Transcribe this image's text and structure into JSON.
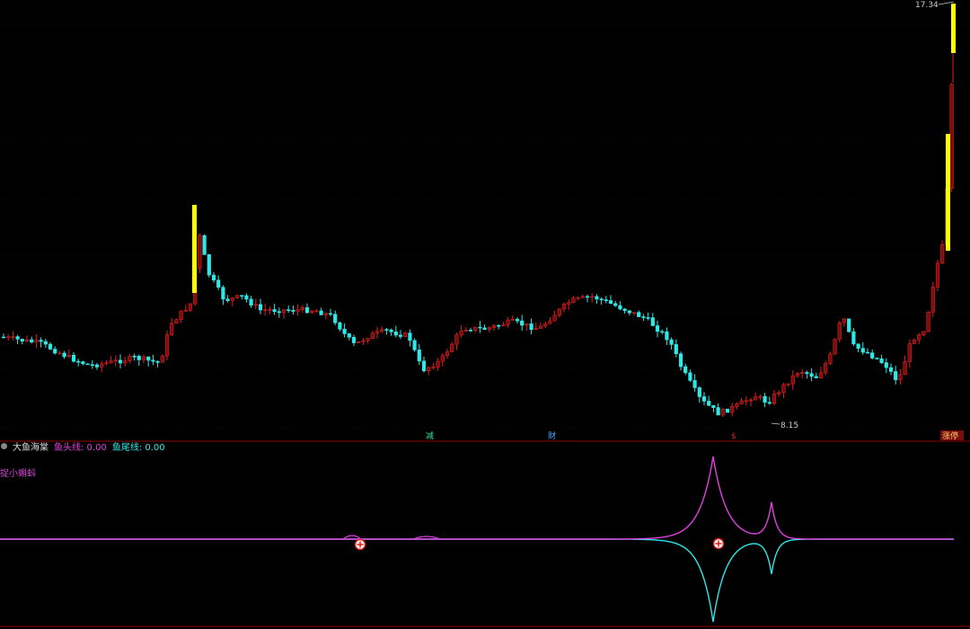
{
  "indicator": {
    "name": "大鱼海棠",
    "head_label": "鱼头线: 0.00",
    "tail_label": "鱼尾线: 0.00",
    "sub_label": "捉小蝌蚪"
  },
  "price_labels": {
    "high": "17.34",
    "low": "8.15"
  },
  "markers": [
    "减",
    "财",
    "$",
    "涨停"
  ],
  "colors": {
    "up": "#e0201e",
    "up_fill": "#7a0d0d",
    "down": "#2ee8e8",
    "limit_bar": "#ffff00",
    "head_line": "#e040e0",
    "tail_line": "#2ee8e8",
    "grid": "#5a0000",
    "divider": "#8b0000"
  },
  "chart_data": {
    "type": "candlestick",
    "ylim": [
      7.5,
      17.6
    ],
    "price_levels": [
      17.34,
      8.15
    ],
    "indicator_ylim": [
      -1,
      1
    ]
  }
}
